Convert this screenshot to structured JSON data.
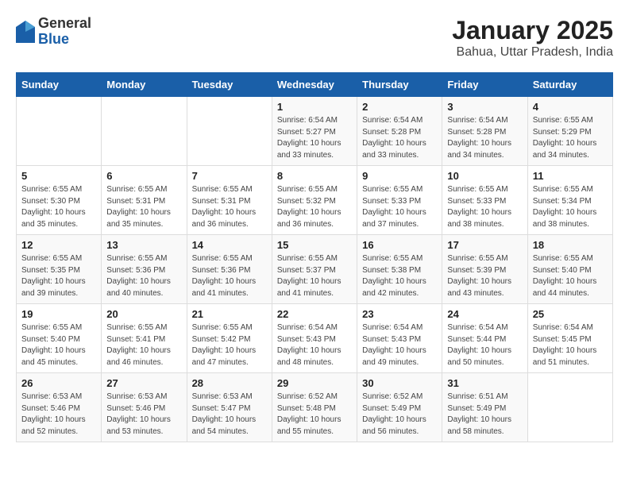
{
  "header": {
    "logo_general": "General",
    "logo_blue": "Blue",
    "title": "January 2025",
    "subtitle": "Bahua, Uttar Pradesh, India"
  },
  "weekdays": [
    "Sunday",
    "Monday",
    "Tuesday",
    "Wednesday",
    "Thursday",
    "Friday",
    "Saturday"
  ],
  "weeks": [
    [
      {
        "day": "",
        "sunrise": "",
        "sunset": "",
        "daylight": ""
      },
      {
        "day": "",
        "sunrise": "",
        "sunset": "",
        "daylight": ""
      },
      {
        "day": "",
        "sunrise": "",
        "sunset": "",
        "daylight": ""
      },
      {
        "day": "1",
        "sunrise": "Sunrise: 6:54 AM",
        "sunset": "Sunset: 5:27 PM",
        "daylight": "Daylight: 10 hours and 33 minutes."
      },
      {
        "day": "2",
        "sunrise": "Sunrise: 6:54 AM",
        "sunset": "Sunset: 5:28 PM",
        "daylight": "Daylight: 10 hours and 33 minutes."
      },
      {
        "day": "3",
        "sunrise": "Sunrise: 6:54 AM",
        "sunset": "Sunset: 5:28 PM",
        "daylight": "Daylight: 10 hours and 34 minutes."
      },
      {
        "day": "4",
        "sunrise": "Sunrise: 6:55 AM",
        "sunset": "Sunset: 5:29 PM",
        "daylight": "Daylight: 10 hours and 34 minutes."
      }
    ],
    [
      {
        "day": "5",
        "sunrise": "Sunrise: 6:55 AM",
        "sunset": "Sunset: 5:30 PM",
        "daylight": "Daylight: 10 hours and 35 minutes."
      },
      {
        "day": "6",
        "sunrise": "Sunrise: 6:55 AM",
        "sunset": "Sunset: 5:31 PM",
        "daylight": "Daylight: 10 hours and 35 minutes."
      },
      {
        "day": "7",
        "sunrise": "Sunrise: 6:55 AM",
        "sunset": "Sunset: 5:31 PM",
        "daylight": "Daylight: 10 hours and 36 minutes."
      },
      {
        "day": "8",
        "sunrise": "Sunrise: 6:55 AM",
        "sunset": "Sunset: 5:32 PM",
        "daylight": "Daylight: 10 hours and 36 minutes."
      },
      {
        "day": "9",
        "sunrise": "Sunrise: 6:55 AM",
        "sunset": "Sunset: 5:33 PM",
        "daylight": "Daylight: 10 hours and 37 minutes."
      },
      {
        "day": "10",
        "sunrise": "Sunrise: 6:55 AM",
        "sunset": "Sunset: 5:33 PM",
        "daylight": "Daylight: 10 hours and 38 minutes."
      },
      {
        "day": "11",
        "sunrise": "Sunrise: 6:55 AM",
        "sunset": "Sunset: 5:34 PM",
        "daylight": "Daylight: 10 hours and 38 minutes."
      }
    ],
    [
      {
        "day": "12",
        "sunrise": "Sunrise: 6:55 AM",
        "sunset": "Sunset: 5:35 PM",
        "daylight": "Daylight: 10 hours and 39 minutes."
      },
      {
        "day": "13",
        "sunrise": "Sunrise: 6:55 AM",
        "sunset": "Sunset: 5:36 PM",
        "daylight": "Daylight: 10 hours and 40 minutes."
      },
      {
        "day": "14",
        "sunrise": "Sunrise: 6:55 AM",
        "sunset": "Sunset: 5:36 PM",
        "daylight": "Daylight: 10 hours and 41 minutes."
      },
      {
        "day": "15",
        "sunrise": "Sunrise: 6:55 AM",
        "sunset": "Sunset: 5:37 PM",
        "daylight": "Daylight: 10 hours and 41 minutes."
      },
      {
        "day": "16",
        "sunrise": "Sunrise: 6:55 AM",
        "sunset": "Sunset: 5:38 PM",
        "daylight": "Daylight: 10 hours and 42 minutes."
      },
      {
        "day": "17",
        "sunrise": "Sunrise: 6:55 AM",
        "sunset": "Sunset: 5:39 PM",
        "daylight": "Daylight: 10 hours and 43 minutes."
      },
      {
        "day": "18",
        "sunrise": "Sunrise: 6:55 AM",
        "sunset": "Sunset: 5:40 PM",
        "daylight": "Daylight: 10 hours and 44 minutes."
      }
    ],
    [
      {
        "day": "19",
        "sunrise": "Sunrise: 6:55 AM",
        "sunset": "Sunset: 5:40 PM",
        "daylight": "Daylight: 10 hours and 45 minutes."
      },
      {
        "day": "20",
        "sunrise": "Sunrise: 6:55 AM",
        "sunset": "Sunset: 5:41 PM",
        "daylight": "Daylight: 10 hours and 46 minutes."
      },
      {
        "day": "21",
        "sunrise": "Sunrise: 6:55 AM",
        "sunset": "Sunset: 5:42 PM",
        "daylight": "Daylight: 10 hours and 47 minutes."
      },
      {
        "day": "22",
        "sunrise": "Sunrise: 6:54 AM",
        "sunset": "Sunset: 5:43 PM",
        "daylight": "Daylight: 10 hours and 48 minutes."
      },
      {
        "day": "23",
        "sunrise": "Sunrise: 6:54 AM",
        "sunset": "Sunset: 5:43 PM",
        "daylight": "Daylight: 10 hours and 49 minutes."
      },
      {
        "day": "24",
        "sunrise": "Sunrise: 6:54 AM",
        "sunset": "Sunset: 5:44 PM",
        "daylight": "Daylight: 10 hours and 50 minutes."
      },
      {
        "day": "25",
        "sunrise": "Sunrise: 6:54 AM",
        "sunset": "Sunset: 5:45 PM",
        "daylight": "Daylight: 10 hours and 51 minutes."
      }
    ],
    [
      {
        "day": "26",
        "sunrise": "Sunrise: 6:53 AM",
        "sunset": "Sunset: 5:46 PM",
        "daylight": "Daylight: 10 hours and 52 minutes."
      },
      {
        "day": "27",
        "sunrise": "Sunrise: 6:53 AM",
        "sunset": "Sunset: 5:46 PM",
        "daylight": "Daylight: 10 hours and 53 minutes."
      },
      {
        "day": "28",
        "sunrise": "Sunrise: 6:53 AM",
        "sunset": "Sunset: 5:47 PM",
        "daylight": "Daylight: 10 hours and 54 minutes."
      },
      {
        "day": "29",
        "sunrise": "Sunrise: 6:52 AM",
        "sunset": "Sunset: 5:48 PM",
        "daylight": "Daylight: 10 hours and 55 minutes."
      },
      {
        "day": "30",
        "sunrise": "Sunrise: 6:52 AM",
        "sunset": "Sunset: 5:49 PM",
        "daylight": "Daylight: 10 hours and 56 minutes."
      },
      {
        "day": "31",
        "sunrise": "Sunrise: 6:51 AM",
        "sunset": "Sunset: 5:49 PM",
        "daylight": "Daylight: 10 hours and 58 minutes."
      },
      {
        "day": "",
        "sunrise": "",
        "sunset": "",
        "daylight": ""
      }
    ]
  ]
}
